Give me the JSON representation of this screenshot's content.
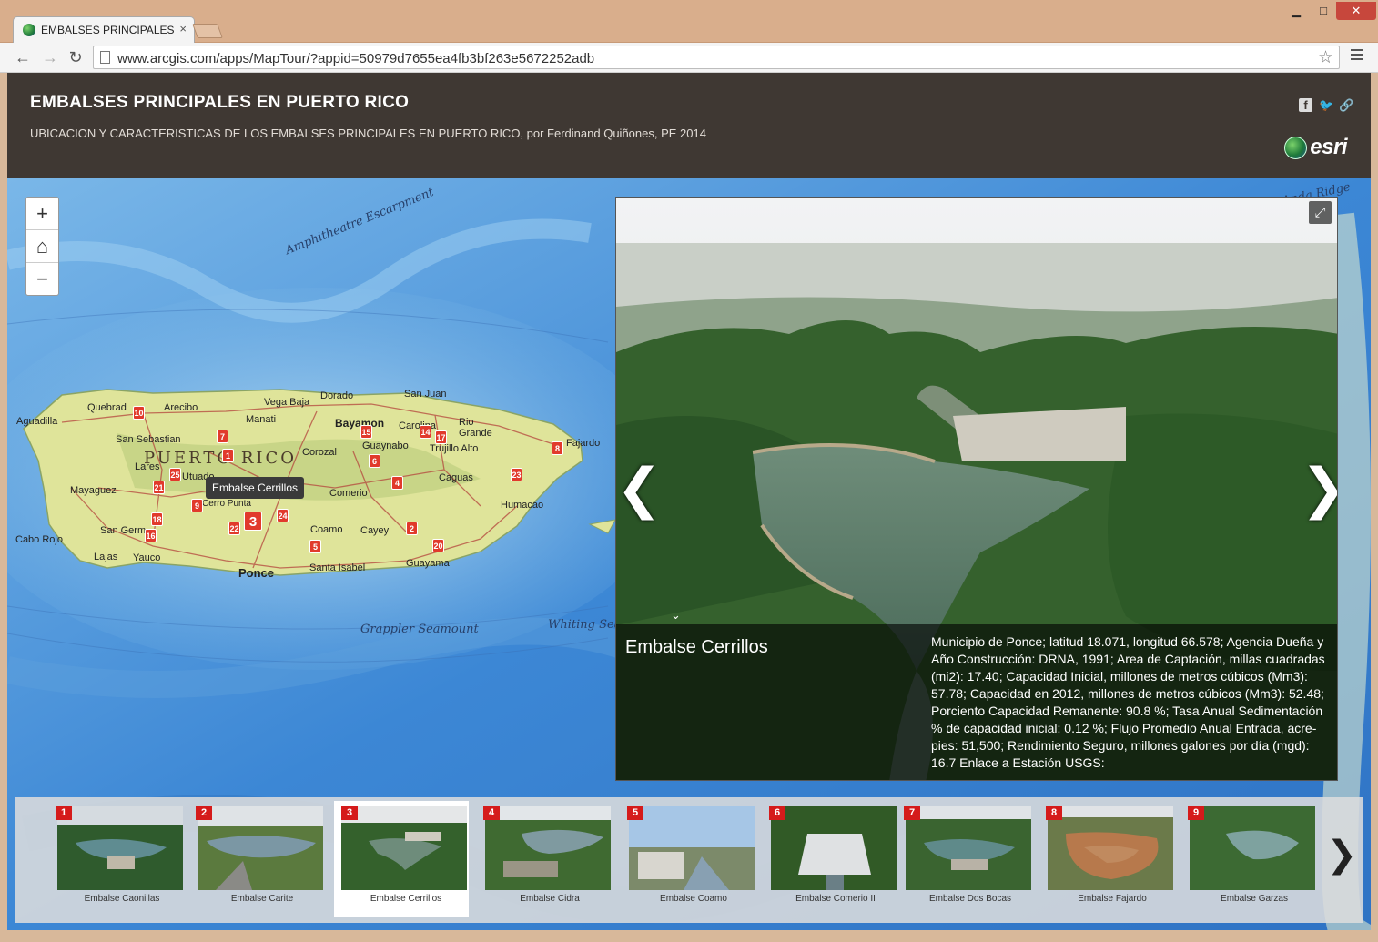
{
  "browser": {
    "tab_title": "EMBALSES PRINCIPALES E",
    "url": "www.arcgis.com/apps/MapTour/?appid=50979d7655ea4fb3bf263e5672252adb",
    "window_controls": {
      "minimize": "▁",
      "maximize": "□",
      "close": "✕"
    }
  },
  "header": {
    "title": "EMBALSES PRINCIPALES EN PUERTO RICO",
    "subtitle": "UBICACION Y CARACTERISTICAS DE LOS EMBALSES PRINCIPALES EN PUERTO RICO, por Ferdinand Quiñones, PE 2014",
    "logo_text": "esri",
    "share_icons": [
      "facebook-icon",
      "twitter-icon",
      "link-icon"
    ]
  },
  "map": {
    "zoom_in": "+",
    "zoom_out": "−",
    "home": "⌂",
    "tooltip": "Embalse Cerrillos",
    "sea_labels": [
      "Amphitheatre Escarpment",
      "Grappler Seamount",
      "Whiting Sea",
      "Anda Ridge"
    ],
    "island_label": "PUERTO RICO",
    "places": [
      "Aguadilla",
      "Quebrad",
      "Arecibo",
      "Vega Baja",
      "Dorado",
      "San Juan",
      "Bayamon",
      "Carolina",
      "Rio Grande",
      "Manati",
      "San Sebastian",
      "Corozal",
      "Guaynabo",
      "Trujillo Alto",
      "Fajardo",
      "Lares",
      "Utuado",
      "Mayaguez",
      "Comerio",
      "Caguas",
      "Humacao",
      "Cabo Rojo",
      "San Germ",
      "Yauco",
      "Lajas",
      "Coamo",
      "Cayey",
      "Ponce",
      "Santa Isabel",
      "Guayama",
      "Cerro Punta"
    ],
    "pins": [
      "10",
      "7",
      "1",
      "6",
      "4",
      "14",
      "17",
      "8",
      "15",
      "23",
      "25",
      "21",
      "9",
      "18",
      "16",
      "22",
      "24",
      "5",
      "2",
      "20",
      "3"
    ]
  },
  "media": {
    "title": "Embalse Cerrillos",
    "description": "Municipio de Ponce; latitud 18.071, longitud 66.578; Agencia Dueña y Año Construcción: DRNA, 1991; Area de Captación, millas cuadradas (mi2): 17.40; Capacidad Inicial, millones de metros cúbicos (Mm3): 57.78; Capacidad en 2012, millones de metros cúbicos (Mm3): 52.48; Porciento Capacidad Remanente: 90.8 %; Tasa Anual Sedimentación % de capacidad inicial: 0.12 %; Flujo Promedio Anual Entrada, acre-pies: 51,500; Rendimiento Seguro, millones galones por día (mgd): 16.7 Enlace a Estación USGS:",
    "expand_icon": "⤢",
    "prev": "❮",
    "next": "❯",
    "collapse": "⌄"
  },
  "carousel": {
    "selected": 3,
    "items": [
      {
        "num": "1",
        "label": "Embalse Caonillas"
      },
      {
        "num": "2",
        "label": "Embalse Carite"
      },
      {
        "num": "3",
        "label": "Embalse Cerrillos"
      },
      {
        "num": "4",
        "label": "Embalse Cidra"
      },
      {
        "num": "5",
        "label": "Embalse Coamo"
      },
      {
        "num": "6",
        "label": "Embalse Comerio II"
      },
      {
        "num": "7",
        "label": "Embalse Dos Bocas"
      },
      {
        "num": "8",
        "label": "Embalse Fajardo"
      },
      {
        "num": "9",
        "label": "Embalse Garzas"
      }
    ],
    "next": "❯"
  }
}
